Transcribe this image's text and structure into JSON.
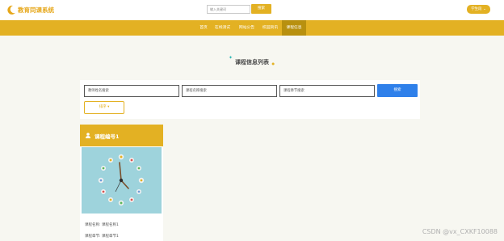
{
  "header": {
    "app_title": "教育同课系统",
    "search_placeholder": "输入关键词",
    "search_button": "搜索",
    "user_menu": "学生段 ⌄"
  },
  "nav": {
    "items": [
      {
        "label": "首页"
      },
      {
        "label": "在线测试"
      },
      {
        "label": "网站公告"
      },
      {
        "label": "校园资讯"
      },
      {
        "label": "课程信息"
      }
    ],
    "active_index": 4
  },
  "page": {
    "title": "课程信息列表"
  },
  "filters": {
    "teacher_placeholder": "教师姓名搜索",
    "course_name_placeholder": "课程名称搜索",
    "chapter_placeholder": "课程章节搜索",
    "search_button": "搜索",
    "sort_button": "排序 ▾"
  },
  "cards": [
    {
      "title": "课程编号1",
      "image_icon": "clock-with-toys-image",
      "lines": [
        {
          "label": "课程名称:",
          "value": "课程名称1"
        },
        {
          "label": "课程章节:",
          "value": "课程章节1"
        }
      ]
    }
  ],
  "watermark": "CSDN @vx_CXKF10088",
  "colors": {
    "accent": "#e3b123",
    "nav_active": "#b8900f",
    "primary_button": "#2f80ea",
    "logo_text": "#e6a71a",
    "card_image_bg": "#9ed3dc"
  }
}
